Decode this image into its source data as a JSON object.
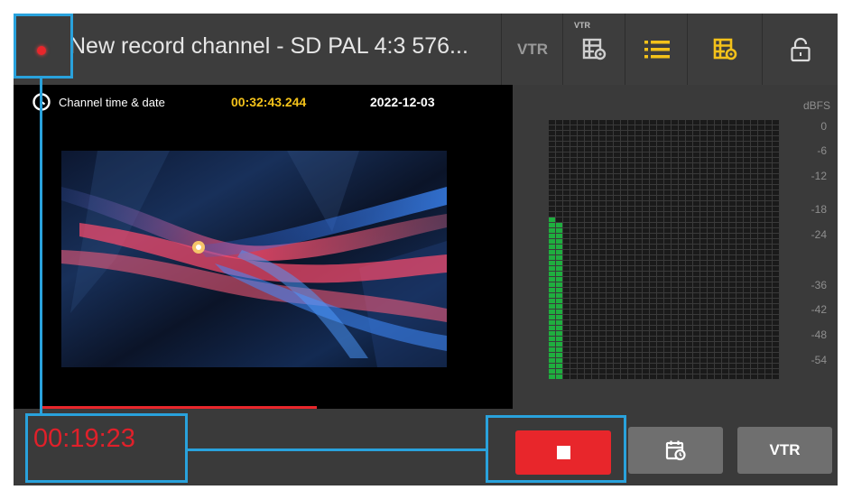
{
  "header": {
    "title": "New record channel - SD PAL 4:3 576...",
    "vtr_label": "VTR",
    "vtr_super": "VTR",
    "icons": [
      "vtr-playlist-icon",
      "list-icon",
      "grid-settings-icon",
      "lock-icon"
    ],
    "accent_color": "#f4c21a"
  },
  "video": {
    "clock_label": "Channel time & date",
    "time": "00:32:43.244",
    "date": "2022-12-03",
    "progress_fraction": 0.62
  },
  "meter": {
    "unit": "dBFS",
    "scale": [
      "0",
      "-6",
      "-12",
      "-18",
      "-24",
      "-36",
      "-42",
      "-48",
      "-54"
    ],
    "levels": [
      0.62,
      0.61
    ],
    "level_color": "#1fae3f"
  },
  "bottom": {
    "timer": "00:19:23",
    "vtr_label": "VTR",
    "record_color": "#e8262b"
  }
}
